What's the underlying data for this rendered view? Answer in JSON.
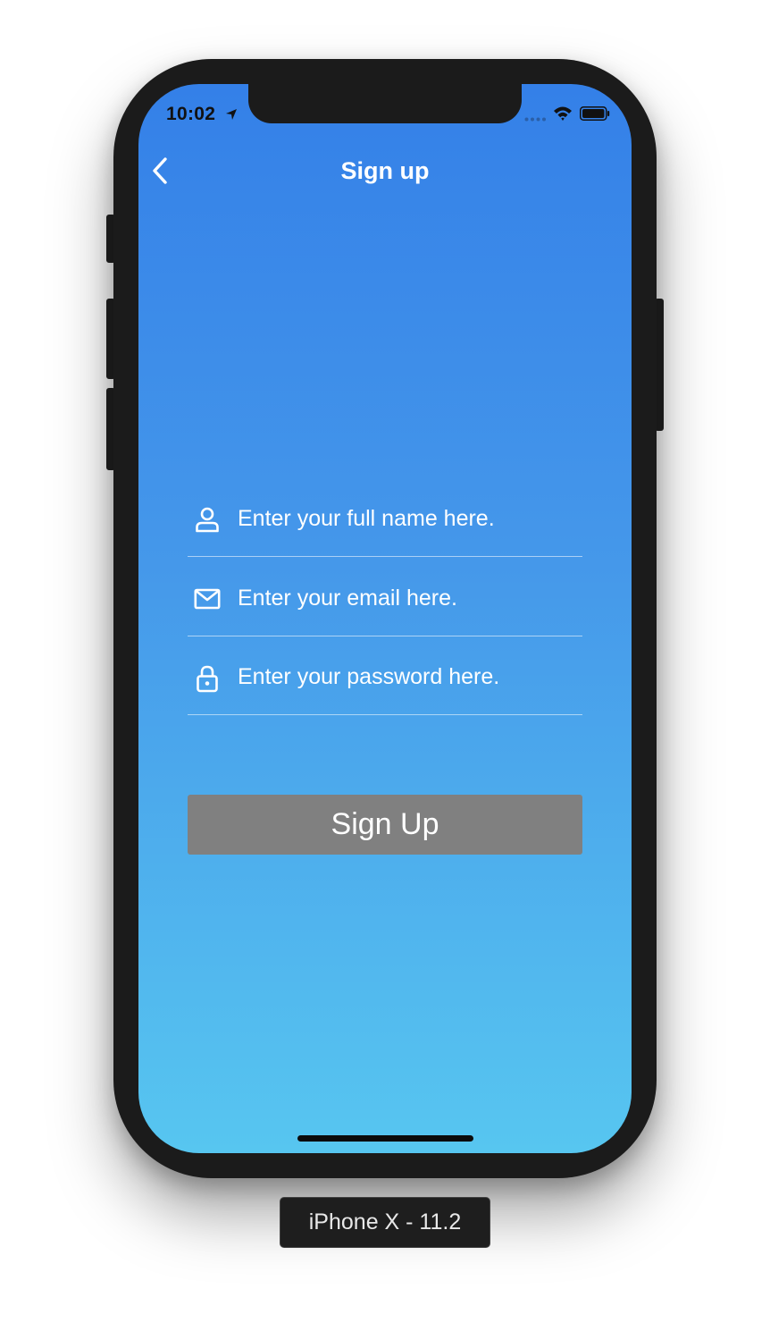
{
  "status_bar": {
    "time": "10:02"
  },
  "nav": {
    "title": "Sign up",
    "back_icon": "chevron-left-icon"
  },
  "form": {
    "name_field": {
      "icon": "user-icon",
      "placeholder": "Enter your full name here.",
      "value": ""
    },
    "email_field": {
      "icon": "mail-icon",
      "placeholder": "Enter your email here.",
      "value": ""
    },
    "password_field": {
      "icon": "lock-icon",
      "placeholder": "Enter your password here.",
      "value": ""
    },
    "submit_label": "Sign Up"
  },
  "device_label": "iPhone X - 11.2",
  "colors": {
    "gradient_top": "#3480e8",
    "gradient_bottom": "#57c6f0",
    "button_bg": "#808080",
    "text": "#ffffff"
  }
}
